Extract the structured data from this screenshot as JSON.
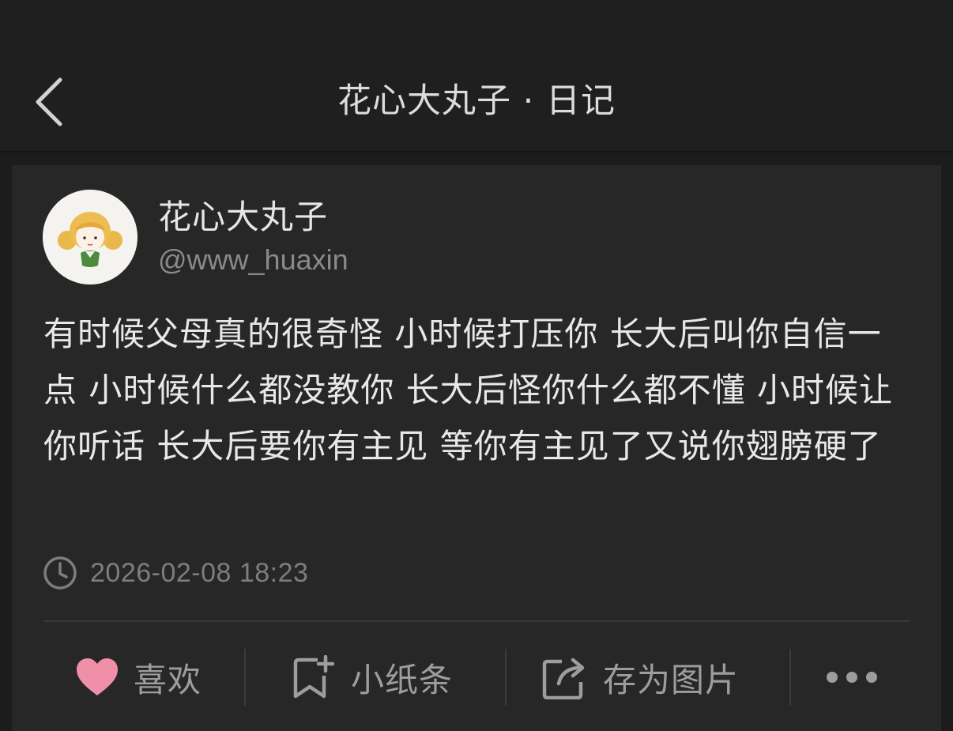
{
  "nav": {
    "title": "花心大丸子 · 日记"
  },
  "post": {
    "author_name": "花心大丸子",
    "author_handle": "@www_huaxin",
    "body": "有时候父母真的很奇怪 小时候打压你 长大后叫你自信一点 小时候什么都没教你 长大后怪你什么都不懂 小时候让你听话 长大后要你有主见 等你有主见了又说你翅膀硬了",
    "timestamp": "2026-02-08 18:23"
  },
  "actions": {
    "like_label": "喜欢",
    "note_label": "小纸条",
    "save_image_label": "存为图片"
  },
  "icons": {
    "back": "chevron-left-icon",
    "clock": "clock-icon",
    "like": "heart-icon",
    "note": "bookmark-plus-icon",
    "share": "share-icon",
    "more": "more-dots-icon"
  },
  "colors": {
    "background": "#1c1c1c",
    "card": "#272727",
    "heart": "#f08fa8",
    "text": "#e8e8e8",
    "muted": "#8a8a8a"
  }
}
